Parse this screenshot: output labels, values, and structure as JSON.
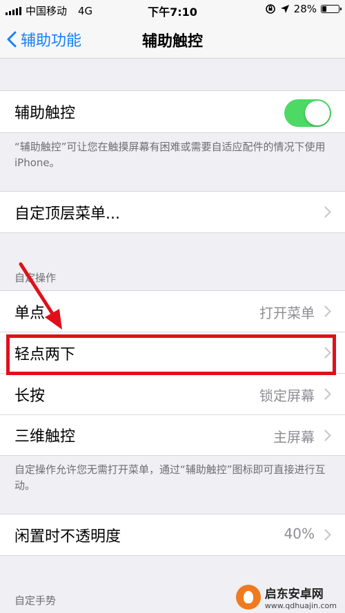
{
  "status": {
    "carrier": "中国移动",
    "network": "4G",
    "time": "下午7:10",
    "battery": "28%",
    "battery_level": 0.28
  },
  "nav": {
    "back_label": "辅助功能",
    "title": "辅助触控"
  },
  "assistive_touch": {
    "label": "辅助触控",
    "enabled": true,
    "footer": "“辅助触控”可让您在触摸屏幕有困难或需要自适应配件的情况下使用 iPhone。"
  },
  "top_menu": {
    "label": "自定顶层菜单..."
  },
  "custom_actions": {
    "header": "自定操作",
    "rows": [
      {
        "label": "单点",
        "value": "打开菜单"
      },
      {
        "label": "轻点两下",
        "value": ""
      },
      {
        "label": "长按",
        "value": "锁定屏幕"
      },
      {
        "label": "三维触控",
        "value": "主屏幕"
      }
    ],
    "footer": "自定操作允许您无需打开菜单，通过“辅助触控”图标即可直接进行互动。"
  },
  "idle_opacity": {
    "label": "闲置时不透明度",
    "value": "40%"
  },
  "custom_gestures": {
    "header": "自定手势"
  },
  "annotation": {
    "color": "#e0101a"
  },
  "watermark": {
    "name": "启东安卓网",
    "url": "www.qdhuajin.com"
  },
  "colors": {
    "accent": "#147efb",
    "toggle_on": "#4cd964"
  }
}
